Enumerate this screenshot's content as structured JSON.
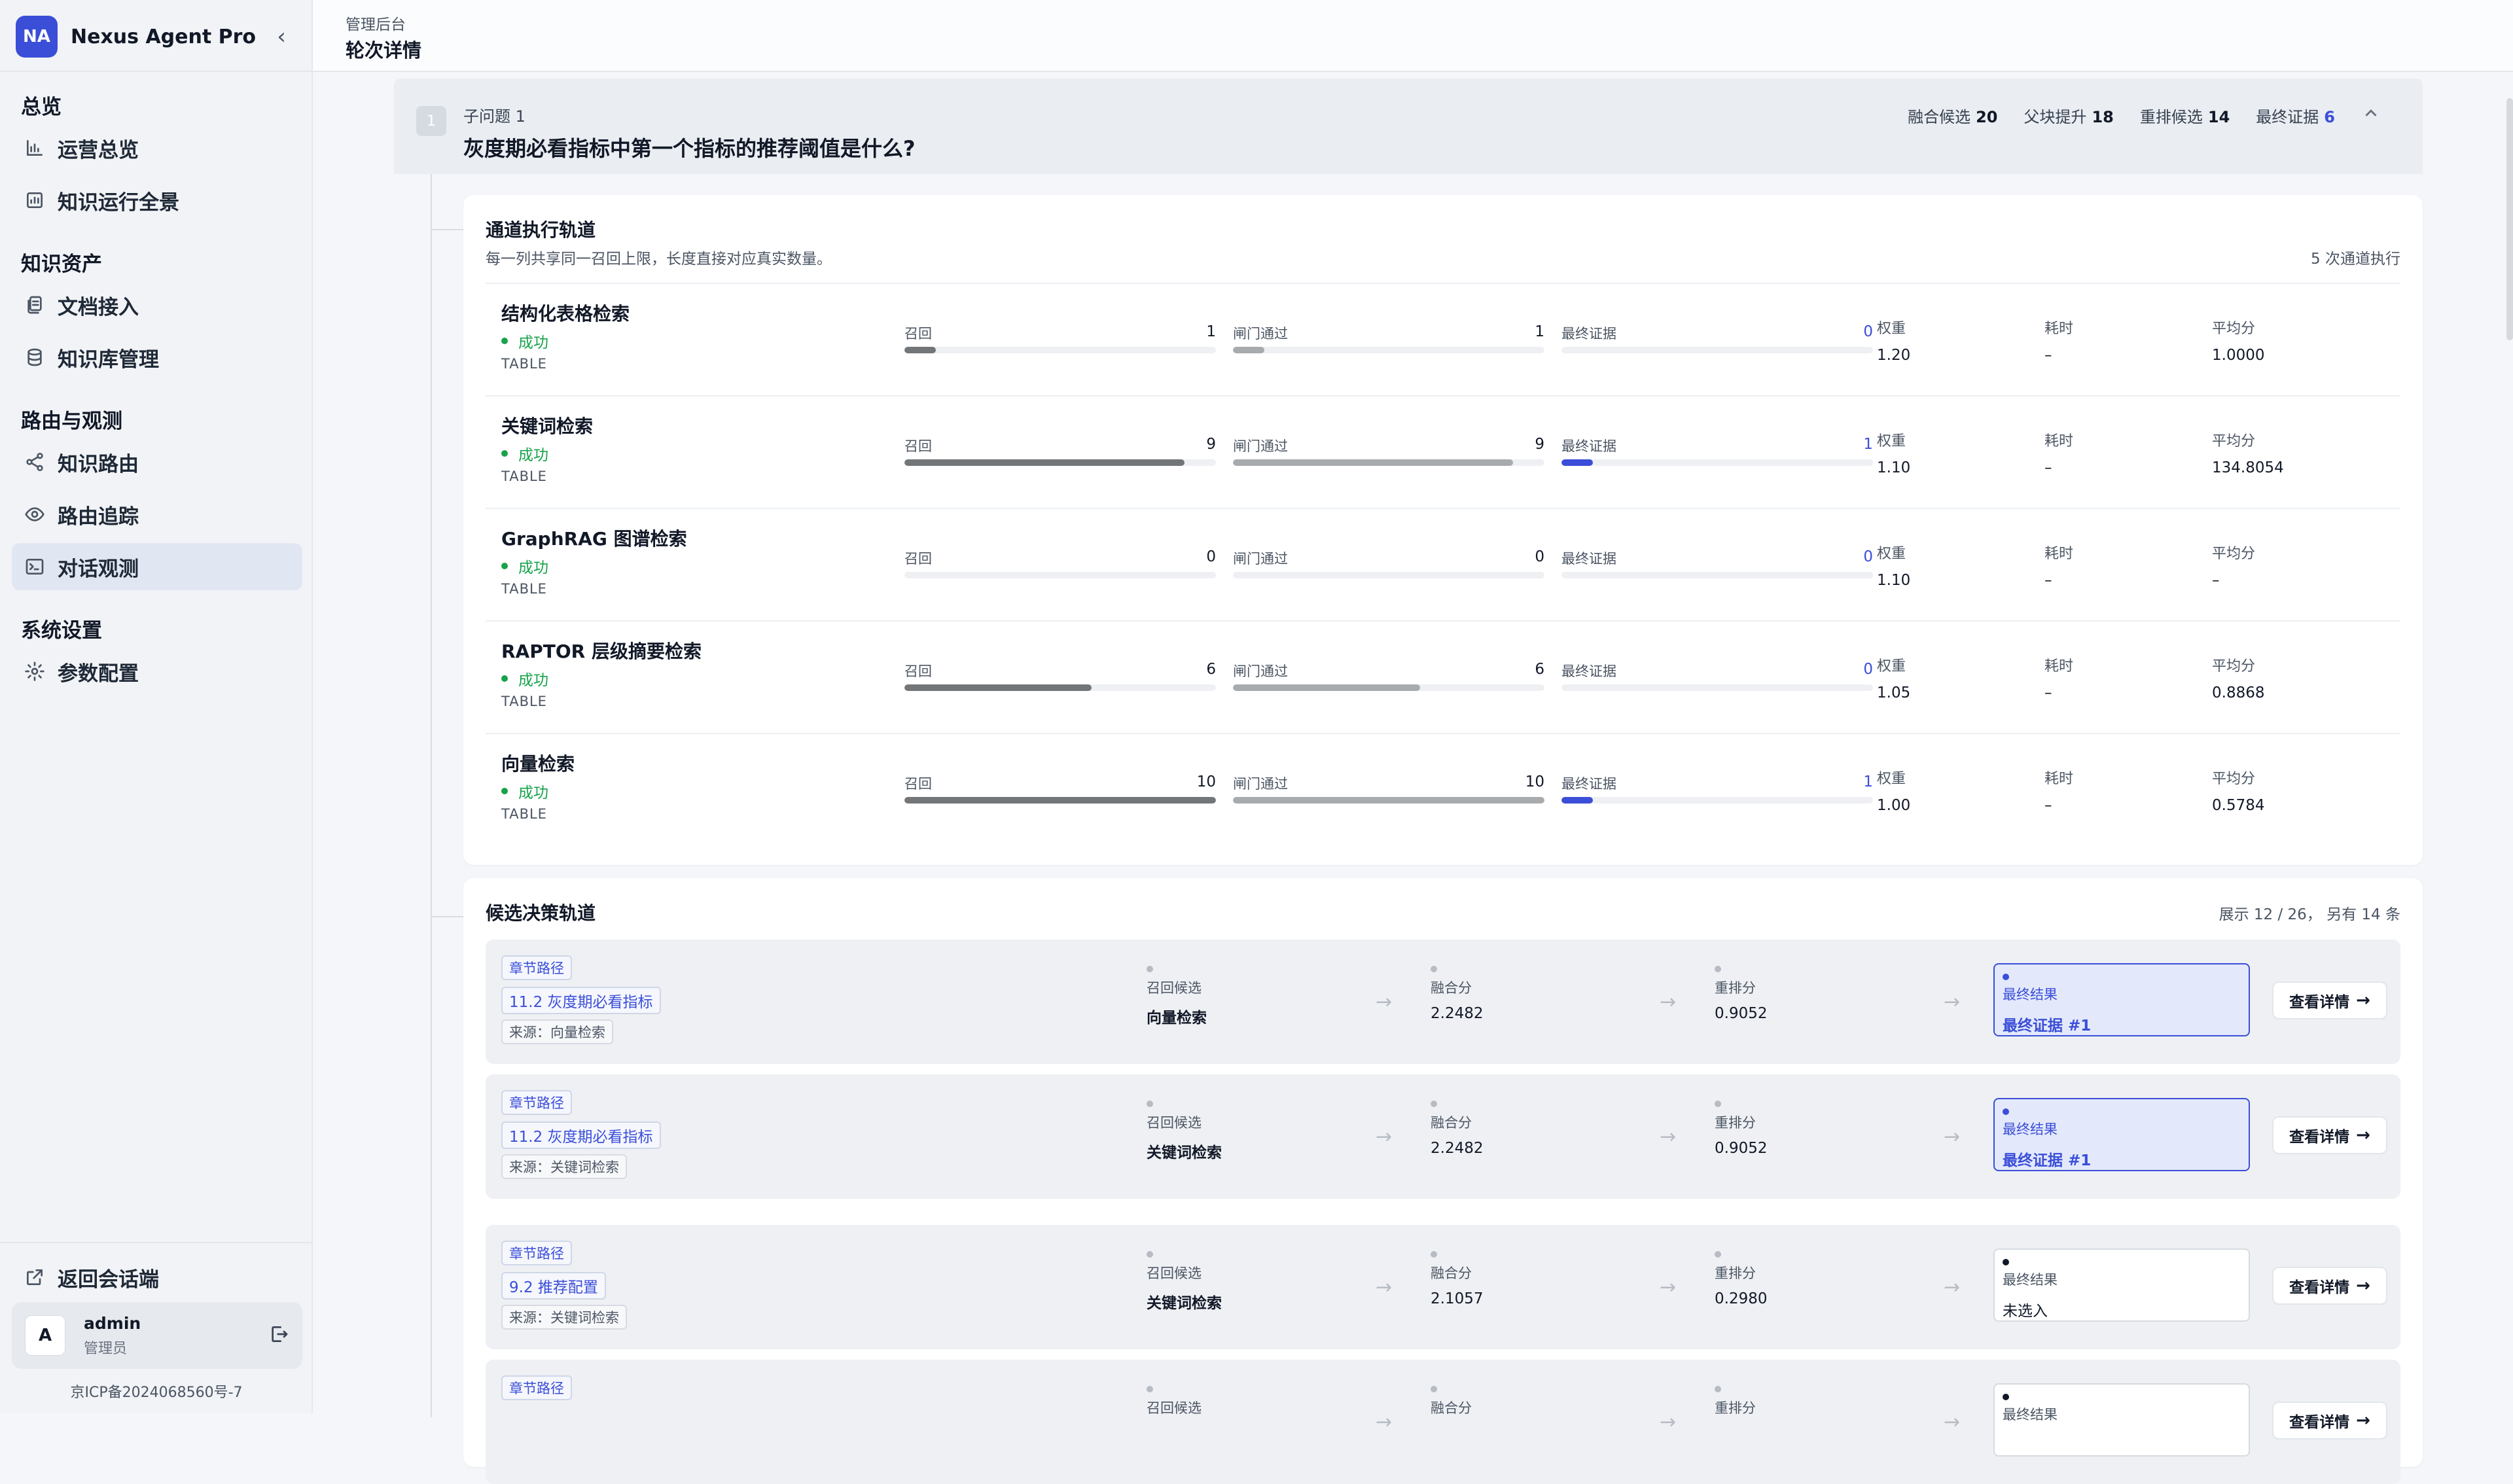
{
  "brand": {
    "logo": "NA",
    "name": "Nexus Agent Pro",
    "collapse_icon": "‹"
  },
  "sidebar": {
    "sections": [
      {
        "title": "总览",
        "items": [
          {
            "label": "运营总览",
            "icon": "chart-bar-icon"
          },
          {
            "label": "知识运行全景",
            "icon": "dashboard-icon"
          }
        ]
      },
      {
        "title": "知识资产",
        "items": [
          {
            "label": "文档接入",
            "icon": "document-icon"
          },
          {
            "label": "知识库管理",
            "icon": "database-icon"
          }
        ]
      },
      {
        "title": "路由与观测",
        "items": [
          {
            "label": "知识路由",
            "icon": "share-icon"
          },
          {
            "label": "路由追踪",
            "icon": "eye-icon"
          },
          {
            "label": "对话观测",
            "icon": "terminal-icon",
            "active": true
          }
        ]
      },
      {
        "title": "系统设置",
        "items": [
          {
            "label": "参数配置",
            "icon": "gear-icon"
          }
        ]
      }
    ],
    "back_label": "返回会话端",
    "user": {
      "avatar": "A",
      "name": "admin",
      "role": "管理员"
    },
    "icp": "京ICP备2024068560号-7"
  },
  "header": {
    "breadcrumb": "管理后台",
    "title": "轮次详情"
  },
  "subquestion": {
    "number": "1",
    "label": "子问题 1",
    "text": "灰度期必看指标中第一个指标的推荐阈值是什么?",
    "stats": [
      {
        "label": "融合候选",
        "value": "20"
      },
      {
        "label": "父块提升",
        "value": "18"
      },
      {
        "label": "重排候选",
        "value": "14"
      },
      {
        "label": "最终证据",
        "value": "6",
        "accent": true
      }
    ]
  },
  "channels": {
    "title": "通道执行轨道",
    "subtitle": "每一列共享同一召回上限，长度直接对应真实数量。",
    "summary": "5 次通道执行",
    "recall_max": 10,
    "metric_labels": {
      "recall": "召回",
      "gate": "闸门通过",
      "final": "最终证据",
      "weight": "权重",
      "latency": "耗时",
      "avg": "平均分"
    },
    "rows": [
      {
        "name": "结构化表格检索",
        "status": "成功",
        "type": "TABLE",
        "recall": 1,
        "gate": 1,
        "final": 0,
        "weight": "1.20",
        "latency": "–",
        "avg": "1.0000"
      },
      {
        "name": "关键词检索",
        "status": "成功",
        "type": "TABLE",
        "recall": 9,
        "gate": 9,
        "final": 1,
        "weight": "1.10",
        "latency": "–",
        "avg": "134.8054"
      },
      {
        "name": "GraphRAG 图谱检索",
        "status": "成功",
        "type": "TABLE",
        "recall": 0,
        "gate": 0,
        "final": 0,
        "weight": "1.10",
        "latency": "–",
        "avg": "–"
      },
      {
        "name": "RAPTOR 层级摘要检索",
        "status": "成功",
        "type": "TABLE",
        "recall": 6,
        "gate": 6,
        "final": 0,
        "weight": "1.05",
        "latency": "–",
        "avg": "0.8868"
      },
      {
        "name": "向量检索",
        "status": "成功",
        "type": "TABLE",
        "recall": 10,
        "gate": 10,
        "final": 1,
        "weight": "1.00",
        "latency": "–",
        "avg": "0.5784"
      }
    ]
  },
  "candidates": {
    "title": "候选决策轨道",
    "summary": "展示 12 / 26， 另有 14 条",
    "stage_labels": {
      "recall": "召回候选",
      "fused": "融合分",
      "rerank": "重排分",
      "final": "最终结果"
    },
    "tag_label": "章节路径",
    "detail_label": "查看详情",
    "items": [
      {
        "path": "11.2 灰度期必看指标",
        "source": "来源：向量检索",
        "recall": "向量检索",
        "fused": "2.2482",
        "rerank": "0.9052",
        "final": "最终证据 #1",
        "hit": true
      },
      {
        "path": "11.2 灰度期必看指标",
        "source": "来源：关键词检索",
        "recall": "关键词检索",
        "fused": "2.2482",
        "rerank": "0.9052",
        "final": "最终证据 #1",
        "hit": true
      },
      {
        "path": "9.2 推荐配置",
        "source": "来源：关键词检索",
        "recall": "关键词检索",
        "fused": "2.1057",
        "rerank": "0.2980",
        "final": "未选入",
        "hit": false
      },
      {
        "path": "",
        "source": "",
        "recall": "",
        "fused": "",
        "rerank": "",
        "final": "",
        "hit": false
      }
    ]
  }
}
